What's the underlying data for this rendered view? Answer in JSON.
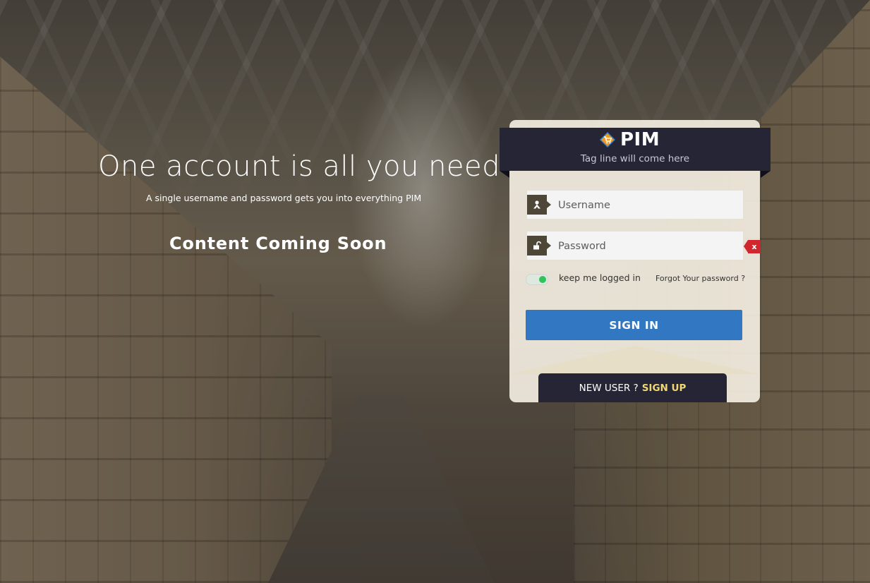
{
  "hero": {
    "headline": "One account is all you need",
    "subline": "A single username and password gets you into everything PIM",
    "coming_soon": "Content Coming Soon"
  },
  "brand": {
    "name": "PIM",
    "tagline": "Tag line will come here",
    "logo_icon": "shopping-cart-diamond-icon",
    "logo_colors": {
      "orange": "#f39a1d",
      "blue": "#2f7fd0"
    }
  },
  "form": {
    "username_placeholder": "Username",
    "username_icon": "user-icon",
    "password_placeholder": "Password",
    "password_icon": "lock-icon",
    "password_error_marker": "x",
    "remember_label": "keep me logged in",
    "remember_checked": true,
    "forgot_label": "Forgot Your password ?",
    "signin_label": "SIGN IN"
  },
  "signup": {
    "prompt": "NEW USER ?",
    "link": "SIGN UP"
  },
  "colors": {
    "banner": "#252536",
    "signin_button": "#3277c1",
    "toggle_on": "#2fc45a",
    "error": "#d0262e",
    "signup_link": "#f1d774"
  }
}
